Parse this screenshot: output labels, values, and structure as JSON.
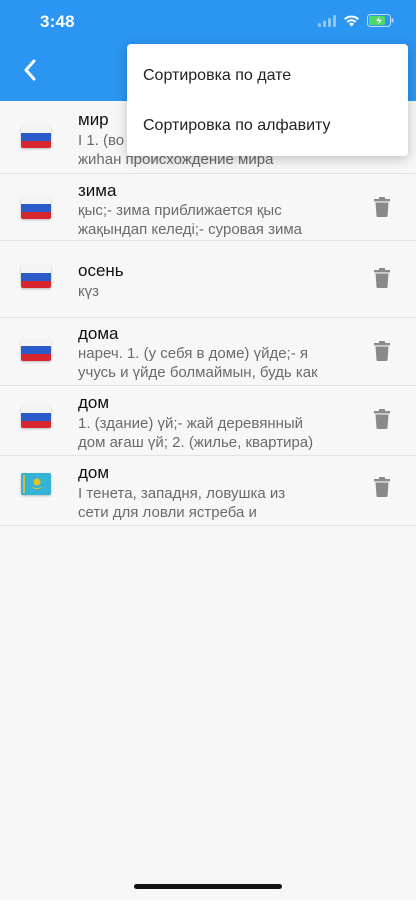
{
  "status_bar": {
    "time": "3:48"
  },
  "colors": {
    "header": "#2b95f2",
    "accent_battery": "#4cd964"
  },
  "menu": {
    "items": [
      {
        "label": "Сортировка по дате"
      },
      {
        "label": "Сортировка по алфавиту"
      }
    ]
  },
  "entries": [
    {
      "word": "мир",
      "flag": "ru",
      "translation": " I 1. (во\nжиһан происхождение мира",
      "deletable": false
    },
    {
      "word": "зима",
      "flag": "ru",
      "translation": " қыс;- зима приближается қыс\nжақындап келеді;- суровая зима",
      "deletable": true
    },
    {
      "word": "осень",
      "flag": "ru",
      "translation": " күз",
      "deletable": true
    },
    {
      "word": "дома",
      "flag": "ru",
      "translation": " нареч. 1. (у себя в доме) үйде;- я\nучусь и үйде болмаймын, будь как",
      "deletable": true
    },
    {
      "word": "дом",
      "flag": "ru",
      "translation": " 1. (здание) үй;- жай деревянный\nдом ағаш үй; 2. (жилье, квартира)",
      "deletable": true
    },
    {
      "word": "дом",
      "flag": "kz",
      "translation": " I тенета, западня, ловушка из\nсети для ловли ястреба и",
      "deletable": true
    }
  ]
}
